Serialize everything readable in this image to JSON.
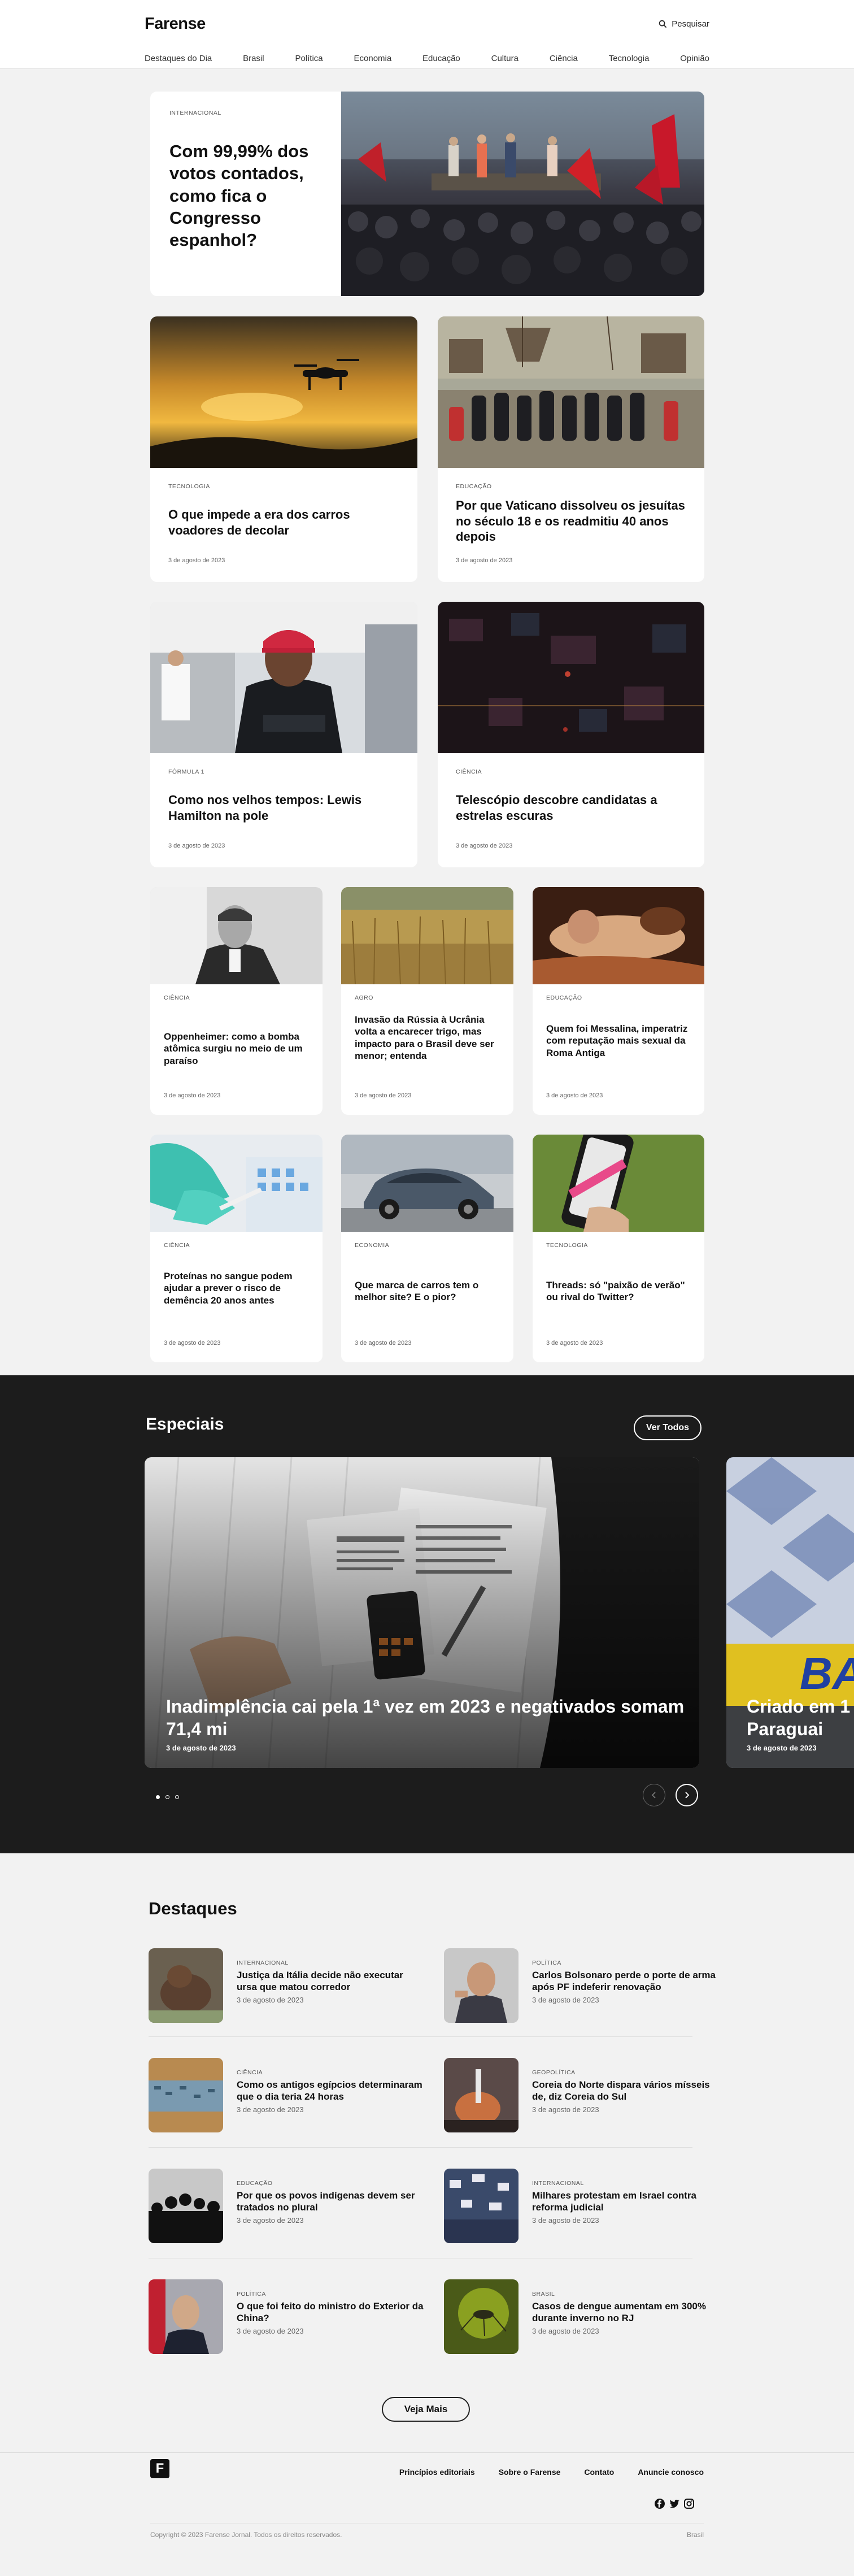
{
  "header": {
    "logo": "Farense",
    "search_label": "Pesquisar"
  },
  "nav": [
    "Destaques do Dia",
    "Brasil",
    "Política",
    "Economia",
    "Educação",
    "Cultura",
    "Ciência",
    "Tecnologia",
    "Opinião"
  ],
  "hero": {
    "category": "INTERNACIONAL",
    "title": "Com 99,99% dos votos contados, como fica o Congresso espanhol?"
  },
  "row2": [
    {
      "category": "TECNOLOGIA",
      "title": "O que impede a era dos carros voadores de decolar",
      "date": "3 de agosto de 2023"
    },
    {
      "category": "EDUCAÇÃO",
      "title": "Por que Vaticano dissolveu os jesuítas no século 18 e os readmitiu 40 anos depois",
      "date": "3 de agosto de 2023"
    }
  ],
  "row3": [
    {
      "category": "FÓRMULA 1",
      "title": "Como nos velhos tempos: Lewis Hamilton na pole",
      "date": "3 de agosto de 2023"
    },
    {
      "category": "CIÊNCIA",
      "title": "Telescópio descobre candidatas a estrelas escuras",
      "date": "3 de agosto de 2023"
    }
  ],
  "row4": [
    {
      "category": "CIÊNCIA",
      "title": "Oppenheimer: como a bomba atômica surgiu no meio de um paraíso",
      "date": "3 de agosto de 2023"
    },
    {
      "category": "AGRO",
      "title": "Invasão da Rússia à Ucrânia volta a encarecer trigo, mas impacto para o Brasil deve ser menor; entenda",
      "date": "3 de agosto de 2023"
    },
    {
      "category": "EDUCAÇÃO",
      "title": "Quem foi Messalina, imperatriz com reputação mais sexual da Roma Antiga",
      "date": "3 de agosto de 2023"
    }
  ],
  "row5": [
    {
      "category": "CIÊNCIA",
      "title": "Proteínas no sangue podem ajudar a prever o risco de demência 20 anos antes",
      "date": "3 de agosto de 2023"
    },
    {
      "category": "ECONOMIA",
      "title": "Que marca de carros tem o melhor site? E o pior?",
      "date": "3 de agosto de 2023"
    },
    {
      "category": "TECNOLOGIA",
      "title": "Threads: só \"paixão de verão\" ou rival do Twitter?",
      "date": "3 de agosto de 2023"
    }
  ],
  "especiais": {
    "title": "Especiais",
    "ver_todos": "Ver Todos",
    "slides": [
      {
        "title": "Inadimplência cai pela 1ª vez em 2023 e negativados somam 71,4 mi",
        "date": "3 de agosto de 2023"
      },
      {
        "title": "Criado em 1… Paraguai",
        "title_line1": "Criado em 1",
        "title_line2": "Paraguai",
        "date": "3 de agosto de 2023"
      }
    ]
  },
  "destaques": {
    "title": "Destaques",
    "items": [
      {
        "category": "INTERNACIONAL",
        "title": "Justiça da Itália decide não executar ursa que matou corredor",
        "date": "3 de agosto de 2023"
      },
      {
        "category": "POLÍTICA",
        "title": "Carlos Bolsonaro perde o porte de arma após PF indeferir renovação",
        "date": "3 de agosto de 2023"
      },
      {
        "category": "CIÊNCIA",
        "title": "Como os antigos egípcios determinaram que o dia teria 24 horas",
        "date": "3 de agosto de 2023"
      },
      {
        "category": "GEOPOLÍTICA",
        "title": "Coreia do Norte dispara vários mísseis de, diz Coreia do Sul",
        "date": "3 de agosto de 2023"
      },
      {
        "category": "EDUCAÇÃO",
        "title": "Por que os povos indígenas devem ser tratados no plural",
        "date": "3 de agosto de 2023"
      },
      {
        "category": "INTERNACIONAL",
        "title": "Milhares protestam em Israel contra reforma judicial",
        "date": "3 de agosto de 2023"
      },
      {
        "category": "POLÍTICA",
        "title": "O que foi feito do ministro do Exterior da China?",
        "date": "3 de agosto de 2023"
      },
      {
        "category": "BRASIL",
        "title": "Casos de dengue aumentam em 300% durante inverno no RJ",
        "date": "3 de agosto de 2023"
      }
    ],
    "ver_mais": "Veja Mais"
  },
  "footer": {
    "logo_letter": "F",
    "links": [
      "Princípios editoriais",
      "Sobre o Farense",
      "Contato",
      "Anuncie conosco"
    ],
    "copyright": "Copyright © 2023 Farense Jornal. Todos os direitos reservados.",
    "region": "Brasil"
  }
}
